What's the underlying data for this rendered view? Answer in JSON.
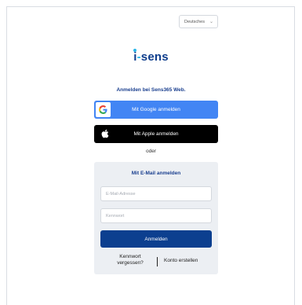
{
  "language_selector": {
    "value": "Deutsches"
  },
  "logo": {
    "text_i": "i",
    "text_dash": "-",
    "text_rest": "sens"
  },
  "signin": {
    "title": "Anmelden bei Sens365 Web.",
    "google_label": "Mit Google anmelden",
    "apple_label": "Mit Apple anmelden",
    "or_label": "oder"
  },
  "email_panel": {
    "title": "Mit E-Mail anmelden",
    "email_placeholder": "E-Mail-Adresse",
    "password_placeholder": "Kennwort",
    "submit_label": "Anmelden",
    "forgot_line1": "Kennwort",
    "forgot_line2": "vergessen?",
    "create_account_label": "Konto erstellen"
  },
  "colors": {
    "brand_blue": "#0c3f8f",
    "google_blue": "#4285f4",
    "apple_black": "#000000",
    "accent_cyan": "#29b6e8"
  }
}
